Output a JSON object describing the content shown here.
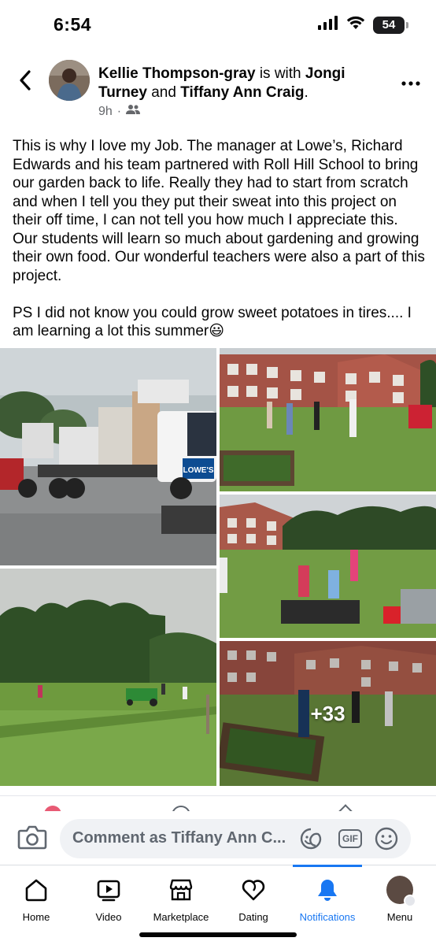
{
  "status_bar": {
    "time": "6:54",
    "battery": "54",
    "icons": [
      "cellular-signal-icon",
      "wifi-icon",
      "battery-icon"
    ]
  },
  "post": {
    "author": "Kellie Thompson-gray",
    "with_text": "is with",
    "tagged_1": "Jongi Turney",
    "and_text": "and",
    "tagged_2": "Tiffany Ann Craig",
    "period": ".",
    "time_ago": "9h",
    "separator": "·",
    "audience_icon": "friends-icon",
    "body": "This is why I love my Job.  The manager at Lowe’s, Richard Edwards and his team partnered with Roll Hill School to bring our garden back to life. Really they had to start from scratch and when I tell you they put their sweat into this project on their off time, I can not tell you how much I appreciate this. Our students will learn so much about gardening and growing their own food. Our wonderful teachers were also a part of this project.\n\nPS  I did not know you could grow sweet potatoes in tires.... I am learning a lot this summer😃",
    "photos_more": "+33",
    "truck_label": "LOWE'S"
  },
  "comment_bar": {
    "placeholder": "Comment as Tiffany Ann C...",
    "gif_label": "GIF"
  },
  "bottom_nav": {
    "items": [
      {
        "label": "Home",
        "icon": "home-icon"
      },
      {
        "label": "Video",
        "icon": "video-icon"
      },
      {
        "label": "Marketplace",
        "icon": "marketplace-icon"
      },
      {
        "label": "Dating",
        "icon": "dating-icon"
      },
      {
        "label": "Notifications",
        "icon": "bell-icon"
      },
      {
        "label": "Menu",
        "icon": "profile-avatar"
      }
    ],
    "active": "Notifications"
  },
  "colors": {
    "accent": "#1877f2",
    "text": "#050505",
    "secondary_text": "#65676b",
    "input_bg": "#f0f2f5"
  }
}
